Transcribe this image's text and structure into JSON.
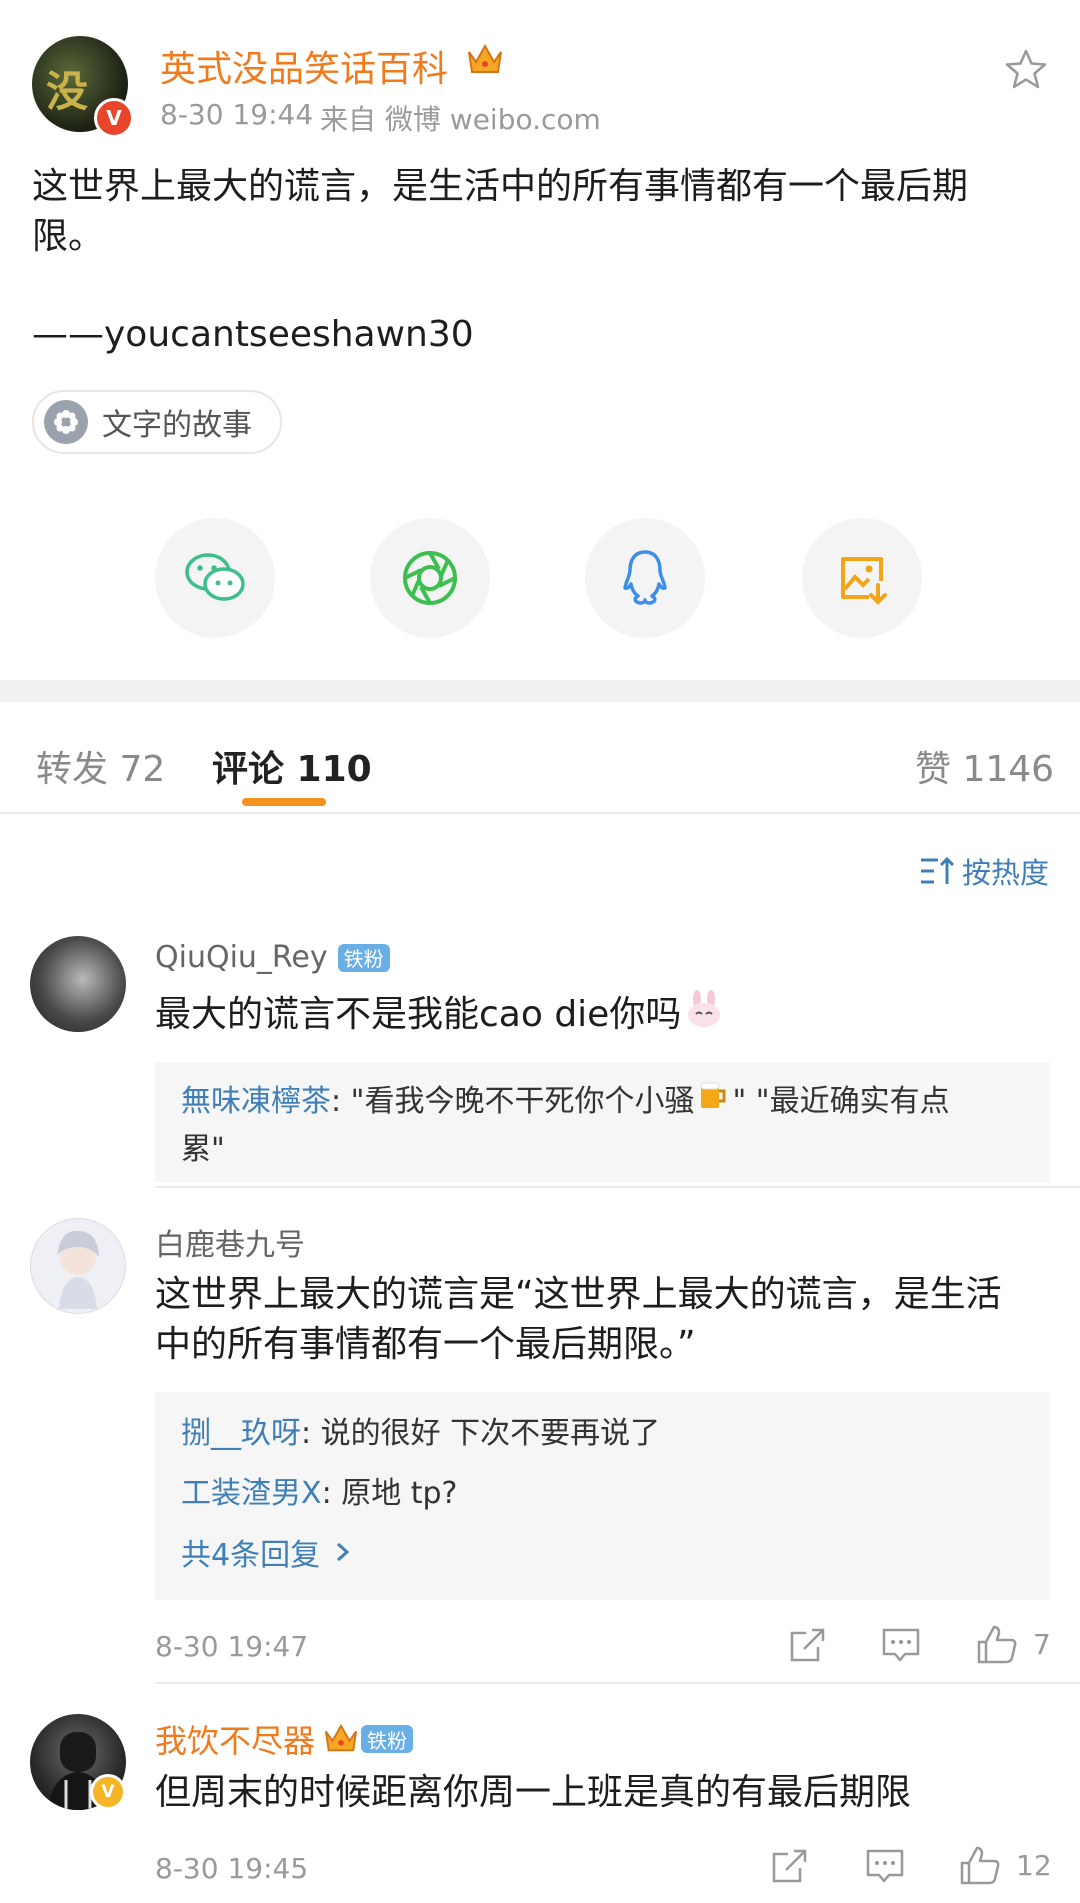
{
  "post": {
    "author": "英式没品笑话百科",
    "time": "8-30 19:44",
    "source": "来自 微博 weibo.com",
    "text_line1": "这世界上最大的谎言，是生活中的所有事情都有一个最后期",
    "text_line2": "限。",
    "signature": "——youcantseeshawn30",
    "topic_tag": "文字的故事"
  },
  "share": [
    "wechat-icon",
    "moments-icon",
    "qq-icon",
    "save-image-icon"
  ],
  "tabs": {
    "repost": "转发 72",
    "comment": "评论 110",
    "like": "赞 1146"
  },
  "sort_label": "按热度",
  "colors": {
    "accent": "#f07a1c",
    "link": "#3f7fb5",
    "fan_badge": "#6aaee6"
  },
  "comments": [
    {
      "user": "QiuQiu_Rey",
      "badge": "铁粉",
      "text": "最大的谎言不是我能cao die你吗",
      "emoji": "rabbit-emoji",
      "reply_user": "無味凍檸茶",
      "reply_text_a": ": \"看我今晚不干死你个小骚",
      "reply_text_b": "\"  \"最近确实有点",
      "reply_text_c": "累\""
    },
    {
      "user": "白鹿巷九号",
      "text_line1": "这世界上最大的谎言是“这世界上最大的谎言，是生活",
      "text_line2": "中的所有事情都有一个最后期限。”",
      "replies": [
        {
          "user": "捌__玖呀",
          "text": ": 说的很好 下次不要再说了"
        },
        {
          "user": "工装渣男X",
          "text": ": 原地 tp?"
        }
      ],
      "more": "共4条回复",
      "time": "8-30 19:47",
      "likes": "7"
    },
    {
      "user": "我饮不尽器",
      "badge": "铁粉",
      "text": "但周末的时候距离你周一上班是真的有最后期限",
      "time": "8-30 19:45",
      "likes": "12"
    }
  ]
}
